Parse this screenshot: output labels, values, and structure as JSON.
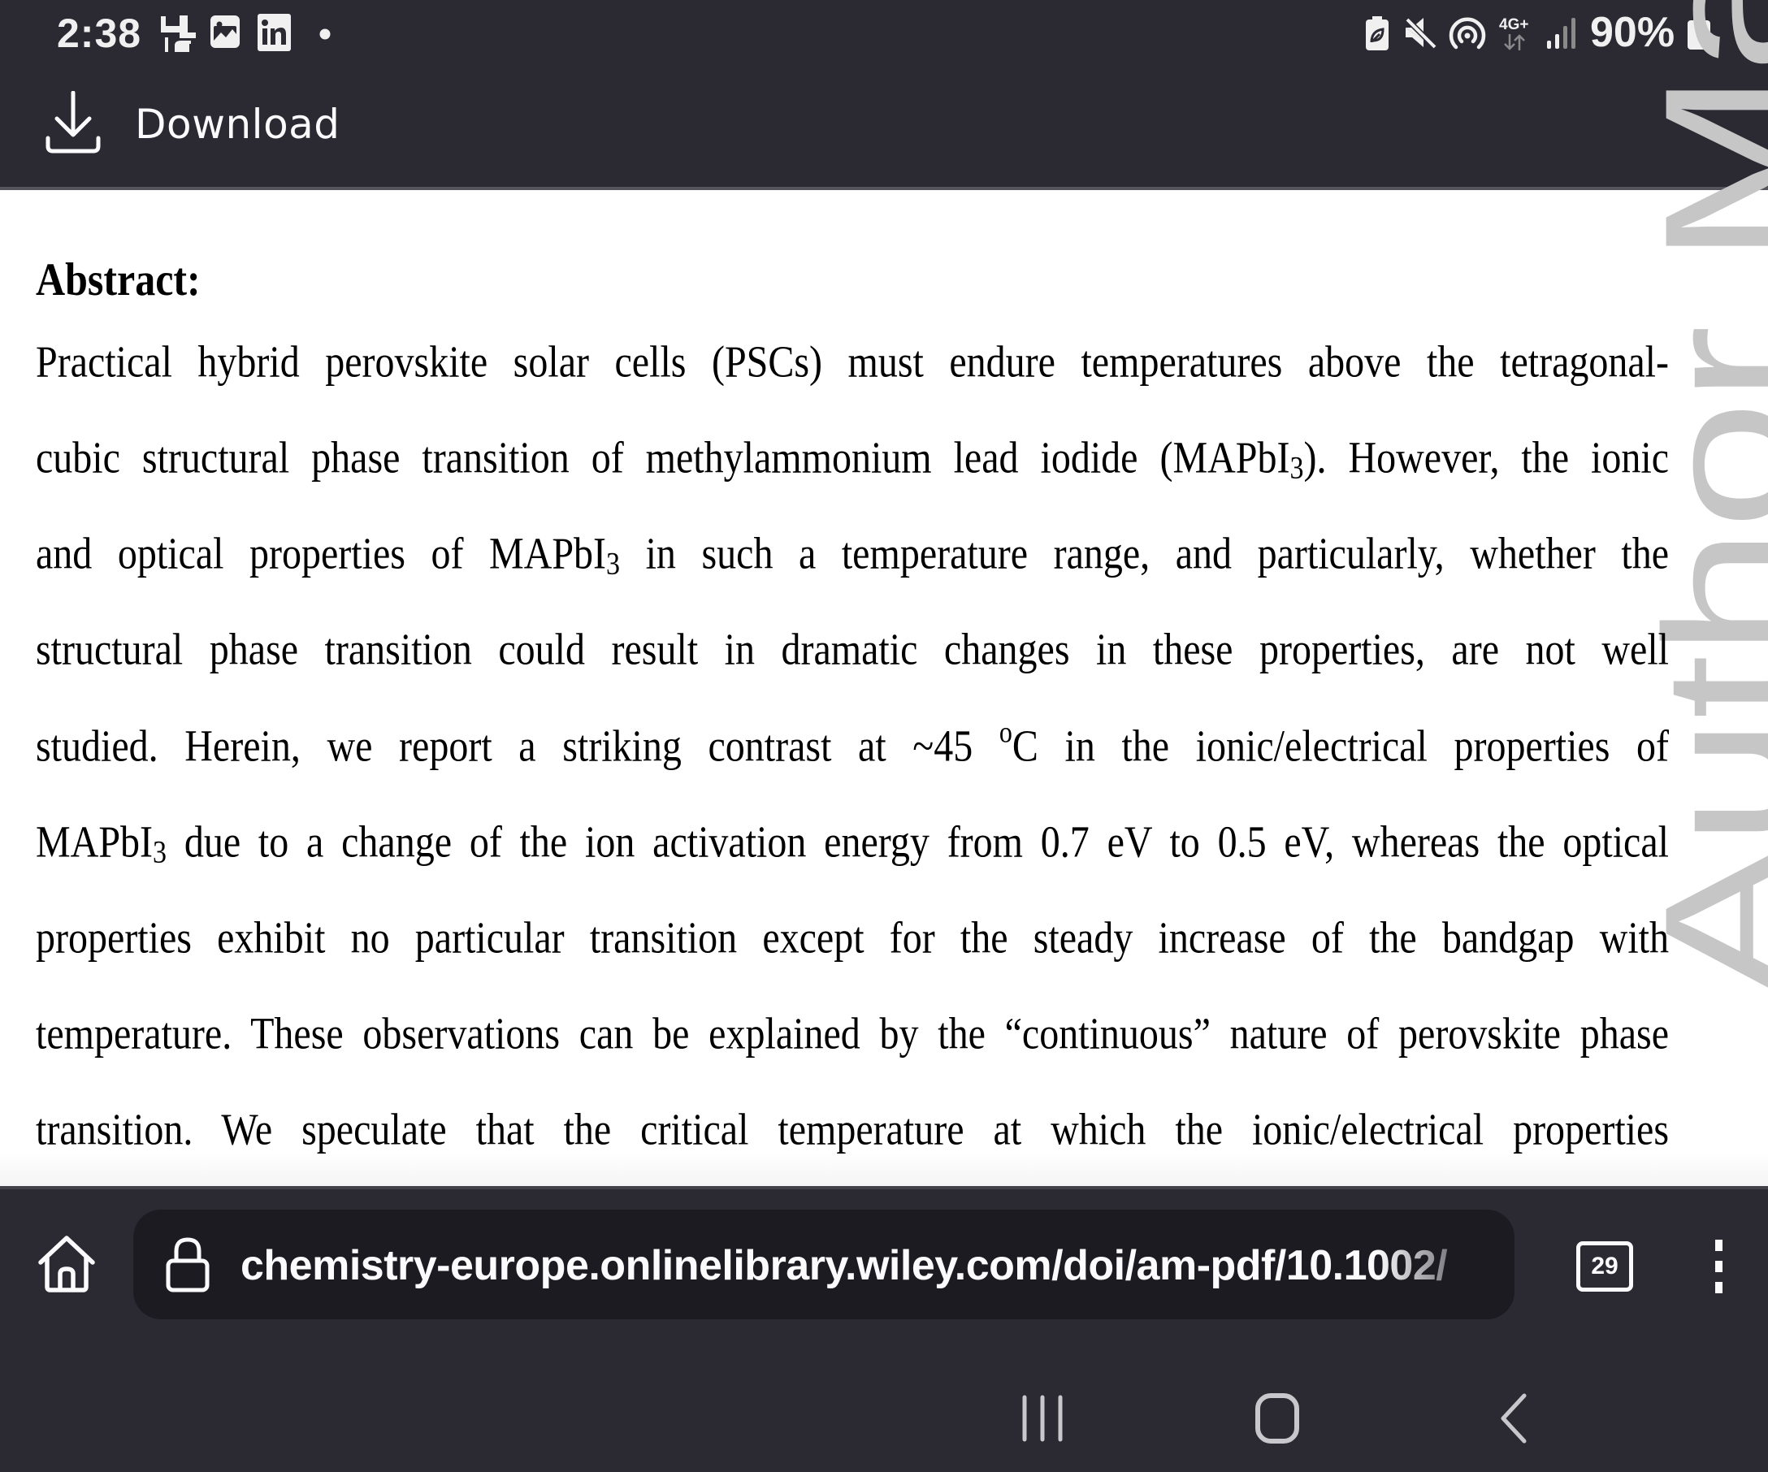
{
  "status_bar": {
    "time": "2:38",
    "left_icons": [
      "accessibility-app-icon",
      "gallery-notification-icon",
      "linkedin-notification-icon",
      "more-notifications-dot-icon"
    ],
    "right_icons": [
      "battery-saver-icon",
      "mute-icon",
      "hotspot-icon",
      "network-4g-plus-icon",
      "signal-strength-icon",
      "battery-icon"
    ],
    "network_label": "4G+",
    "battery_percent": "90%"
  },
  "header": {
    "download_label": "Download"
  },
  "document": {
    "heading": "Abstract:",
    "watermark": "Author Manuscript",
    "lines": [
      {
        "parts": [
          {
            "t": "Practical hybrid perovskite solar cells (PSCs) must endure temperatures above the tetragonal-"
          }
        ]
      },
      {
        "parts": [
          {
            "t": "cubic structural phase transition of methylammonium lead iodide (MAPbI"
          },
          {
            "sub": "3"
          },
          {
            "t": "). However, the ionic"
          }
        ]
      },
      {
        "parts": [
          {
            "t": "and optical properties of MAPbI"
          },
          {
            "sub": "3"
          },
          {
            "t": " in such a temperature range, and particularly, whether the"
          }
        ]
      },
      {
        "parts": [
          {
            "t": "structural phase transition could result in dramatic changes in these properties, are not well"
          }
        ]
      },
      {
        "parts": [
          {
            "t": "studied. Herein, we report a striking contrast at ~45 "
          },
          {
            "sup": "o"
          },
          {
            "t": "C in the ionic/electrical properties of"
          }
        ]
      },
      {
        "parts": [
          {
            "t": "MAPbI"
          },
          {
            "sub": "3"
          },
          {
            "t": " due to a change of the ion activation energy from 0.7 eV to 0.5 eV, whereas the optical"
          }
        ]
      },
      {
        "parts": [
          {
            "t": "properties exhibit no particular transition except for the steady increase of the bandgap with"
          }
        ]
      },
      {
        "parts": [
          {
            "t": "temperature. These observations can be explained by the “continuous” nature of perovskite phase"
          }
        ]
      },
      {
        "parts": [
          {
            "t": "transition. We speculate that the critical temperature at which the ionic/electrical properties"
          }
        ]
      }
    ]
  },
  "browser_toolbar": {
    "url": "chemistry-europe.onlinelibrary.wiley.com/doi/am-pdf/10.1002/",
    "tab_count": "29"
  },
  "nav_bar": {
    "buttons": [
      "recent-apps",
      "home",
      "back"
    ]
  },
  "colors": {
    "chrome_bg": "#2b2a33",
    "url_pill_bg": "#1c1b22",
    "chrome_text": "#fbfbfe",
    "watermark": "#c6c6c6",
    "nav_icon": "#c8c8cc"
  }
}
